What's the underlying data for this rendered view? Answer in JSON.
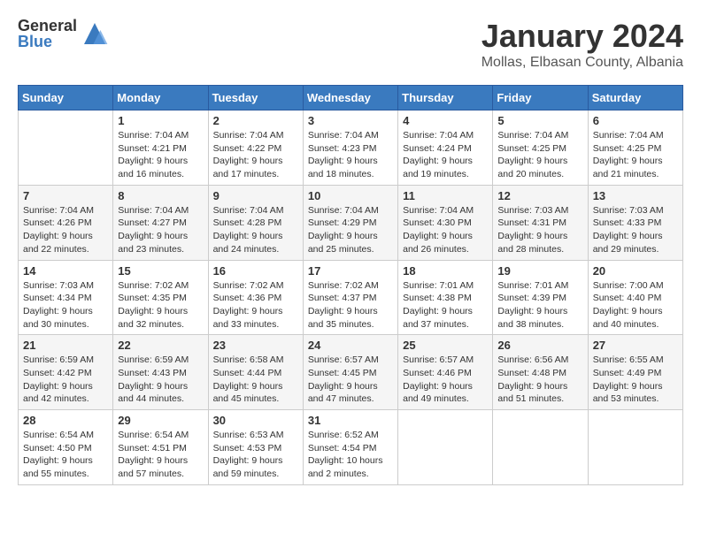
{
  "header": {
    "logo": {
      "general": "General",
      "blue": "Blue"
    },
    "title": "January 2024",
    "location": "Mollas, Elbasan County, Albania"
  },
  "weekdays": [
    "Sunday",
    "Monday",
    "Tuesday",
    "Wednesday",
    "Thursday",
    "Friday",
    "Saturday"
  ],
  "weeks": [
    [
      {
        "day": null
      },
      {
        "day": 1,
        "sunrise": "7:04 AM",
        "sunset": "4:21 PM",
        "daylight": "9 hours and 16 minutes."
      },
      {
        "day": 2,
        "sunrise": "7:04 AM",
        "sunset": "4:22 PM",
        "daylight": "9 hours and 17 minutes."
      },
      {
        "day": 3,
        "sunrise": "7:04 AM",
        "sunset": "4:23 PM",
        "daylight": "9 hours and 18 minutes."
      },
      {
        "day": 4,
        "sunrise": "7:04 AM",
        "sunset": "4:24 PM",
        "daylight": "9 hours and 19 minutes."
      },
      {
        "day": 5,
        "sunrise": "7:04 AM",
        "sunset": "4:25 PM",
        "daylight": "9 hours and 20 minutes."
      },
      {
        "day": 6,
        "sunrise": "7:04 AM",
        "sunset": "4:25 PM",
        "daylight": "9 hours and 21 minutes."
      }
    ],
    [
      {
        "day": 7,
        "sunrise": "7:04 AM",
        "sunset": "4:26 PM",
        "daylight": "9 hours and 22 minutes."
      },
      {
        "day": 8,
        "sunrise": "7:04 AM",
        "sunset": "4:27 PM",
        "daylight": "9 hours and 23 minutes."
      },
      {
        "day": 9,
        "sunrise": "7:04 AM",
        "sunset": "4:28 PM",
        "daylight": "9 hours and 24 minutes."
      },
      {
        "day": 10,
        "sunrise": "7:04 AM",
        "sunset": "4:29 PM",
        "daylight": "9 hours and 25 minutes."
      },
      {
        "day": 11,
        "sunrise": "7:04 AM",
        "sunset": "4:30 PM",
        "daylight": "9 hours and 26 minutes."
      },
      {
        "day": 12,
        "sunrise": "7:03 AM",
        "sunset": "4:31 PM",
        "daylight": "9 hours and 28 minutes."
      },
      {
        "day": 13,
        "sunrise": "7:03 AM",
        "sunset": "4:33 PM",
        "daylight": "9 hours and 29 minutes."
      }
    ],
    [
      {
        "day": 14,
        "sunrise": "7:03 AM",
        "sunset": "4:34 PM",
        "daylight": "9 hours and 30 minutes."
      },
      {
        "day": 15,
        "sunrise": "7:02 AM",
        "sunset": "4:35 PM",
        "daylight": "9 hours and 32 minutes."
      },
      {
        "day": 16,
        "sunrise": "7:02 AM",
        "sunset": "4:36 PM",
        "daylight": "9 hours and 33 minutes."
      },
      {
        "day": 17,
        "sunrise": "7:02 AM",
        "sunset": "4:37 PM",
        "daylight": "9 hours and 35 minutes."
      },
      {
        "day": 18,
        "sunrise": "7:01 AM",
        "sunset": "4:38 PM",
        "daylight": "9 hours and 37 minutes."
      },
      {
        "day": 19,
        "sunrise": "7:01 AM",
        "sunset": "4:39 PM",
        "daylight": "9 hours and 38 minutes."
      },
      {
        "day": 20,
        "sunrise": "7:00 AM",
        "sunset": "4:40 PM",
        "daylight": "9 hours and 40 minutes."
      }
    ],
    [
      {
        "day": 21,
        "sunrise": "6:59 AM",
        "sunset": "4:42 PM",
        "daylight": "9 hours and 42 minutes."
      },
      {
        "day": 22,
        "sunrise": "6:59 AM",
        "sunset": "4:43 PM",
        "daylight": "9 hours and 44 minutes."
      },
      {
        "day": 23,
        "sunrise": "6:58 AM",
        "sunset": "4:44 PM",
        "daylight": "9 hours and 45 minutes."
      },
      {
        "day": 24,
        "sunrise": "6:57 AM",
        "sunset": "4:45 PM",
        "daylight": "9 hours and 47 minutes."
      },
      {
        "day": 25,
        "sunrise": "6:57 AM",
        "sunset": "4:46 PM",
        "daylight": "9 hours and 49 minutes."
      },
      {
        "day": 26,
        "sunrise": "6:56 AM",
        "sunset": "4:48 PM",
        "daylight": "9 hours and 51 minutes."
      },
      {
        "day": 27,
        "sunrise": "6:55 AM",
        "sunset": "4:49 PM",
        "daylight": "9 hours and 53 minutes."
      }
    ],
    [
      {
        "day": 28,
        "sunrise": "6:54 AM",
        "sunset": "4:50 PM",
        "daylight": "9 hours and 55 minutes."
      },
      {
        "day": 29,
        "sunrise": "6:54 AM",
        "sunset": "4:51 PM",
        "daylight": "9 hours and 57 minutes."
      },
      {
        "day": 30,
        "sunrise": "6:53 AM",
        "sunset": "4:53 PM",
        "daylight": "9 hours and 59 minutes."
      },
      {
        "day": 31,
        "sunrise": "6:52 AM",
        "sunset": "4:54 PM",
        "daylight": "10 hours and 2 minutes."
      },
      {
        "day": null
      },
      {
        "day": null
      },
      {
        "day": null
      }
    ]
  ]
}
